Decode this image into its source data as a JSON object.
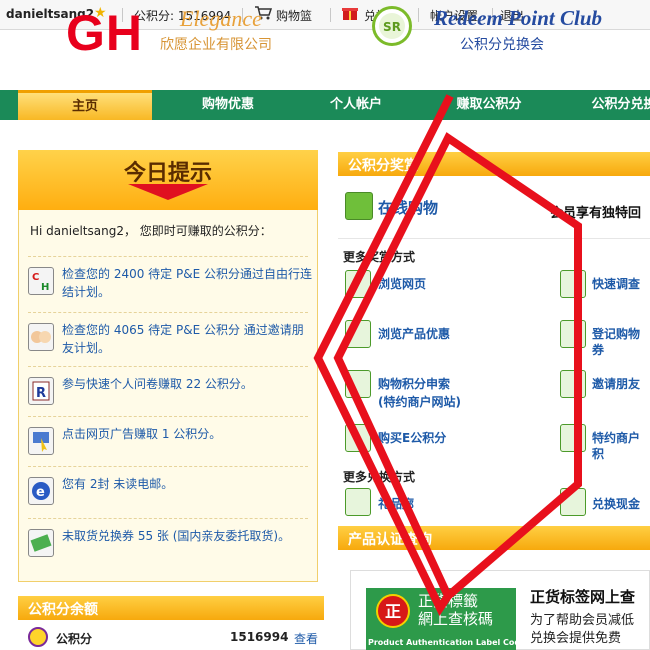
{
  "userbar": {
    "username": "danieltsang2",
    "points_text": "公积分: 1516994",
    "cart": "购物篮",
    "redeem": "兑换篮",
    "account": "帐户设置",
    "logout": "退出"
  },
  "header": {
    "logo_text": "GH",
    "brand": "Elegance",
    "company": "欣愿企业有限公司",
    "club_logo_letters": "SR",
    "club": "Redeem Point Club",
    "club_cn": "公积分兑换会"
  },
  "nav": {
    "tabs": [
      {
        "label": "主页"
      },
      {
        "label": "购物优惠"
      },
      {
        "label": "个人帐户"
      },
      {
        "label": "赚取公积分"
      },
      {
        "label": "公积分兑换"
      }
    ]
  },
  "today": {
    "title": "今日提示",
    "greeting": "Hi danieltsang2， 您即时可赚取的公积分：",
    "tips": [
      {
        "icon": "ch-icon",
        "text": "检查您的 2400 待定 P&E 公积分通过自由行连结计划。"
      },
      {
        "icon": "friends-icon",
        "text": "检查您的 4065 待定 P&E 公积分 通过邀请朋友计划。"
      },
      {
        "icon": "survey-icon",
        "text": "参与快速个人问卷赚取 22 公积分。"
      },
      {
        "icon": "click-icon",
        "text": "点击网页广告赚取 1 公积分。"
      },
      {
        "icon": "email-icon",
        "text": "您有 2封 未读电邮。"
      },
      {
        "icon": "coupon-icon",
        "text": "未取货兑换券 55 张 (国内亲友委托取货)。"
      }
    ]
  },
  "balance": {
    "title": "公积分余额",
    "label": "公积分",
    "value": "1516994",
    "view": "查看"
  },
  "rewards": {
    "title": "公积分奖赏",
    "online_shop": "在线购物",
    "member_text": "会员享有独特回",
    "earn_more_title": "更多奖赏方式",
    "earn_items": [
      {
        "label": "浏览网页"
      },
      {
        "label": "快速调查"
      },
      {
        "label": "浏览产品优惠"
      },
      {
        "label": "登记购物券"
      },
      {
        "label": "购物积分申索"
      },
      {
        "label": "(特约商户网站)"
      },
      {
        "label": "邀请朋友"
      },
      {
        "label": "购买E公积分"
      },
      {
        "label": "特约商户积"
      }
    ],
    "redeem_more_title": "更多兑换方式",
    "redeem_items": [
      {
        "label": "礼品廊"
      },
      {
        "label": "兑换现金"
      }
    ]
  },
  "product": {
    "title": "产品认证查询",
    "seal_text": "正",
    "banner_line1": "正貨標籤",
    "banner_line2": "網上查核碼",
    "banner_en": "Product Authentication Label Code",
    "headline": "正货标签网上查",
    "desc_line1": "为了帮助会员减低",
    "desc_line2": "兑换会提供免费"
  },
  "colors": {
    "nav_green": "#1b8a58",
    "accent_orange": "#f7a90d",
    "logo_red": "#e8001c",
    "link_blue": "#1e5aa8",
    "annotation_red": "#e8101c"
  }
}
